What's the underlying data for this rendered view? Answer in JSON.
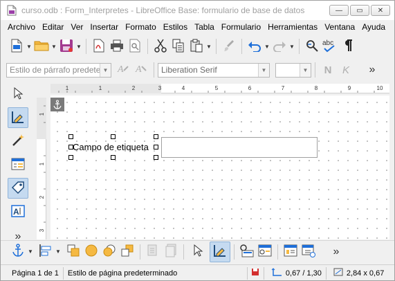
{
  "window": {
    "title": "curso.odb : Form_Interpretes - LibreOffice Base: formulario de base de datos",
    "minimize_glyph": "—",
    "maximize_glyph": "▭",
    "close_glyph": "✕"
  },
  "menu": [
    "Archivo",
    "Editar",
    "Ver",
    "Insertar",
    "Formato",
    "Estilos",
    "Tabla",
    "Formulario",
    "Herramientas",
    "Ventana",
    "Ayuda"
  ],
  "format_toolbar": {
    "paragraph_style": "Estilo de párrafo predetermin",
    "font_name": "Liberation Serif",
    "font_size": "",
    "bold_label": "N",
    "italic_label": "K"
  },
  "ruler": {
    "h_ticks": [
      "1",
      "1",
      "2",
      "3",
      "4",
      "5",
      "6",
      "7",
      "8",
      "9",
      "10"
    ],
    "v_ticks": [
      "1",
      "1",
      "2",
      "3"
    ]
  },
  "form": {
    "label_text": "Campo de etiqueta",
    "text_field_value": ""
  },
  "more_glyph": "»",
  "statusbar": {
    "page": "Página 1 de 1",
    "page_style": "Estilo de página predeterminado",
    "position": "0,67 / 1,30",
    "size": "2,84 x 0,67"
  },
  "colors": {
    "accent": "#1e6fd9",
    "selected_bg": "#c5daf0",
    "dot_grid": "#b4b4b4"
  }
}
